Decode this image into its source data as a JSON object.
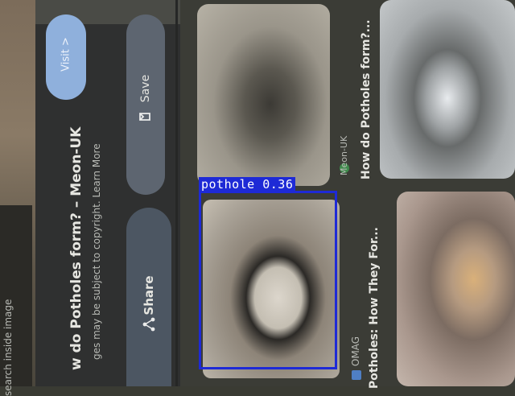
{
  "panel": {
    "visit_label": "Visit >",
    "save_label": "Save",
    "title": "How do Potholes form? - Meon-UK",
    "title_visible": "w do Potholes form? – Meon-UK",
    "copyright_text": "ges may be subject to copyright. Learn More",
    "share_label": "Share",
    "left_strip_text": "search inside image"
  },
  "results": [
    {
      "source": "Meon-UK",
      "title": "How do Potholes form?..."
    },
    {
      "source": "OMAG",
      "title": "Potholes: How They For..."
    }
  ],
  "detection": {
    "label": "pothole 0.36",
    "class": "pothole",
    "score": 0.36,
    "color": "#1e2ad6"
  },
  "icons": {
    "save": "bookmark-icon",
    "share": "share-icon"
  }
}
